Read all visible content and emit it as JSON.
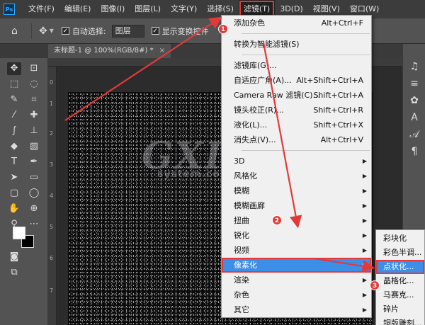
{
  "menubar": {
    "logo": "Ps",
    "items": [
      "文件(F)",
      "编辑(E)",
      "图像(I)",
      "图层(L)",
      "文字(Y)",
      "选择(S)",
      "滤镜(T)",
      "3D(D)",
      "视图(V)",
      "窗口(W)"
    ]
  },
  "options": {
    "auto_select_label": "自动选择:",
    "layer_select": "图层",
    "transform_label": "显示变换控件"
  },
  "document_tab": {
    "title": "未标题-1 @ 100%(RGB/8#) *",
    "close": "×"
  },
  "ruler_left_numbers": [
    "0",
    "1",
    "2",
    "3",
    "4",
    "5",
    "6",
    "7"
  ],
  "filter_menu": {
    "items": [
      {
        "label": "添加杂色",
        "shortcut": "Alt+Ctrl+F"
      },
      {
        "label": "转换为智能滤镜(S)",
        "shortcut": ""
      },
      {
        "label": "滤镜库(G)...",
        "shortcut": ""
      },
      {
        "label": "自适应广角(A)...",
        "shortcut": "Alt+Shift+Ctrl+A"
      },
      {
        "label": "Camera Raw 滤镜(C)...",
        "shortcut": "Shift+Ctrl+A"
      },
      {
        "label": "镜头校正(R)...",
        "shortcut": "Shift+Ctrl+R"
      },
      {
        "label": "液化(L)...",
        "shortcut": "Shift+Ctrl+X"
      },
      {
        "label": "消失点(V)...",
        "shortcut": "Alt+Ctrl+V"
      },
      {
        "label": "3D"
      },
      {
        "label": "风格化"
      },
      {
        "label": "模糊"
      },
      {
        "label": "模糊画廊"
      },
      {
        "label": "扭曲"
      },
      {
        "label": "锐化"
      },
      {
        "label": "视频"
      },
      {
        "label": "像素化"
      },
      {
        "label": "渲染"
      },
      {
        "label": "杂色"
      },
      {
        "label": "其它"
      }
    ]
  },
  "pixelate_submenu": {
    "items": [
      "彩块化",
      "彩色半调...",
      "点状化...",
      "晶格化...",
      "马赛克...",
      "碎片",
      "铜版雕刻..."
    ]
  },
  "watermark": {
    "main": "GXI",
    "sub": "system.com"
  },
  "badges": [
    "1",
    "2",
    "3"
  ],
  "colors": {
    "highlight": "#3d8ee6",
    "annotation": "#e23a3a"
  }
}
